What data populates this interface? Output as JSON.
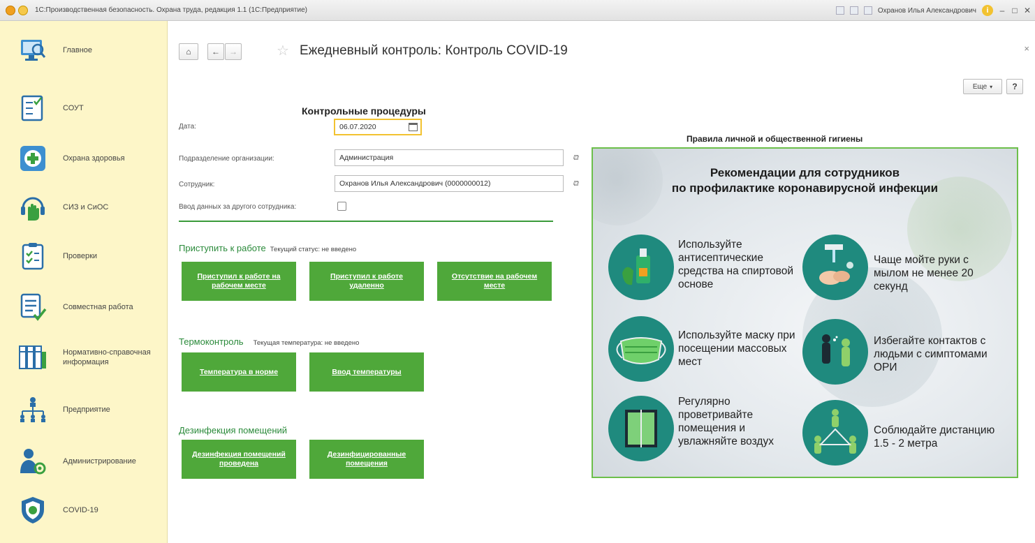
{
  "window": {
    "title": "1С:Производственная безопасность. Охрана труда, редакция 1.1 (1С:Предприятие)",
    "user": "Охранов Илья Александрович"
  },
  "sidebar": {
    "items": [
      {
        "label": "Главное",
        "icon": "monitor-icon"
      },
      {
        "label": "СОУТ",
        "icon": "checklist-icon"
      },
      {
        "label": "Охрана здоровья",
        "icon": "medical-cross-icon"
      },
      {
        "label": "СИЗ и СиОС",
        "icon": "hand-icon"
      },
      {
        "label": "Проверки",
        "icon": "clipboard-icon"
      },
      {
        "label": "Совместная работа",
        "icon": "document-check-icon"
      },
      {
        "label": "Нормативно-справочная информация",
        "icon": "binders-icon"
      },
      {
        "label": "Предприятие",
        "icon": "org-chart-icon"
      },
      {
        "label": "Администрирование",
        "icon": "admin-user-icon"
      },
      {
        "label": "COVID-19",
        "icon": "shield-icon"
      }
    ]
  },
  "header": {
    "title": "Ежедневный контроль: Контроль COVID-19",
    "more_label": "Еще",
    "help_label": "?"
  },
  "form": {
    "heading": "Контрольные процедуры",
    "date_label": "Дата:",
    "date_value": "06.07.2020",
    "department_label": "Подразделение организации:",
    "department_value": "Администрация",
    "employee_label": "Сотрудник:",
    "employee_value": "Охранов Илья Александрович (0000000012)",
    "other_employee_label": "Ввод данных за другого сотрудника:"
  },
  "groups": {
    "work": {
      "title": "Приступить к работе",
      "status": "Текущий статус: не введено",
      "buttons": [
        "Приступил к работе на рабочем месте",
        "Приступил к работе удаленно",
        "Отсутствие на рабочем месте"
      ]
    },
    "thermo": {
      "title": "Термоконтроль",
      "status": "Текущая температура: не введено",
      "buttons": [
        "Температура в норме",
        "Ввод температуры"
      ]
    },
    "disinfection": {
      "title": "Дезинфекция помещений",
      "buttons": [
        "Дезинфекция помещений проведена",
        "Дезинфицированные помещения"
      ]
    }
  },
  "hygiene": {
    "title": "Правила личной и общественной гигиены",
    "poster_title_line1": "Рекомендации для сотрудников",
    "poster_title_line2": "по профилактике коронавирусной инфекции",
    "recommendations": [
      "Используйте антисептические средства на спиртовой основе",
      "Чаще мойте руки с мылом не менее 20 секунд",
      "Используйте маску при посещении массовых мест",
      "Избегайте контактов с людьми с симптомами ОРИ",
      "Регулярно проветривайте помещения и увлажняйте воздух",
      "Соблюдайте дистанцию 1.5 - 2 метра"
    ]
  },
  "colors": {
    "sidebar_bg": "#fdf6c8",
    "accent_green": "#4fa83a",
    "highlight_yellow": "#f2c230",
    "icon_teal": "#1f8a7e"
  }
}
